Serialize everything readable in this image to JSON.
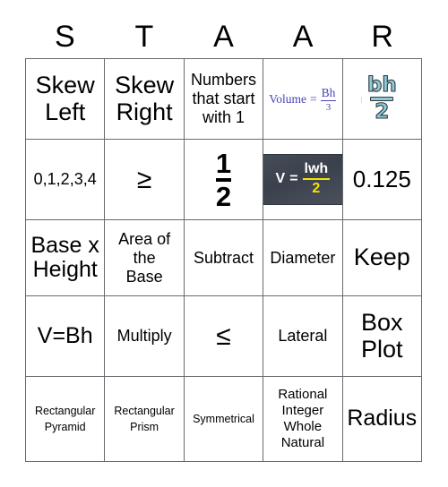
{
  "card": {
    "title_letters": [
      "S",
      "T",
      "A",
      "A",
      "R"
    ],
    "rows": [
      [
        {
          "name": "skew-left",
          "text": "Skew\nLeft",
          "size": "t-xl"
        },
        {
          "name": "skew-right",
          "text": "Skew\nRight",
          "size": "t-xl"
        },
        {
          "name": "numbers-start-1",
          "text": "Numbers\nthat start\nwith 1",
          "size": "t-md"
        },
        {
          "name": "volume-bh-over-3",
          "type": "volume-formula",
          "label": "Volume",
          "equals": "=",
          "numerator": "Bh",
          "denominator": "3",
          "color": "#4a42b8"
        },
        {
          "name": "bh-over-2",
          "type": "bh2-formula",
          "numerator": "bh",
          "denominator": "2",
          "color": "#8ecad9"
        }
      ],
      [
        {
          "name": "zero-to-four",
          "text": "0,1,2,3,4",
          "size": "t-md"
        },
        {
          "name": "greater-or-equal",
          "text": "≥",
          "size": "t-sym"
        },
        {
          "name": "one-half-fraction",
          "type": "big-fraction",
          "numerator": "1",
          "denominator": "2"
        },
        {
          "name": "v-equals-lwh-over-2",
          "type": "chalk-formula",
          "label": "V",
          "equals": "=",
          "numerator": "lwh",
          "denominator": "2",
          "bg_color": "#3f4651",
          "accent_color": "#f5e400"
        },
        {
          "name": "zero-point-one-two-five",
          "text": "0.125",
          "size": "t-num"
        }
      ],
      [
        {
          "name": "base-times-height",
          "text": "Base x\nHeight",
          "size": "t-lg"
        },
        {
          "name": "area-of-the-base",
          "text": "Area of\nthe\nBase",
          "size": "t-md"
        },
        {
          "name": "subtract",
          "text": "Subtract",
          "size": "t-md"
        },
        {
          "name": "diameter",
          "text": "Diameter",
          "size": "t-md"
        },
        {
          "name": "keep",
          "text": "Keep",
          "size": "t-xl"
        }
      ],
      [
        {
          "name": "v-equals-bh",
          "text": "V=Bh",
          "size": "t-lg"
        },
        {
          "name": "multiply",
          "text": "Multiply",
          "size": "t-md"
        },
        {
          "name": "less-or-equal",
          "text": "≤",
          "size": "t-sym"
        },
        {
          "name": "lateral",
          "text": "Lateral",
          "size": "t-md"
        },
        {
          "name": "box-plot",
          "text": "Box\nPlot",
          "size": "t-xl"
        }
      ],
      [
        {
          "name": "rectangular-pyramid",
          "text": "Rectangular\nPyramid",
          "size": "t-xs"
        },
        {
          "name": "rectangular-prism",
          "text": "Rectangular\nPrism",
          "size": "t-xs"
        },
        {
          "name": "symmetrical",
          "text": "Symmetrical",
          "size": "t-xs"
        },
        {
          "name": "number-sets",
          "text": "Rational\nInteger\nWhole\nNatural",
          "size": "t-sm"
        },
        {
          "name": "radius",
          "text": "Radius",
          "size": "t-lg"
        }
      ]
    ]
  }
}
